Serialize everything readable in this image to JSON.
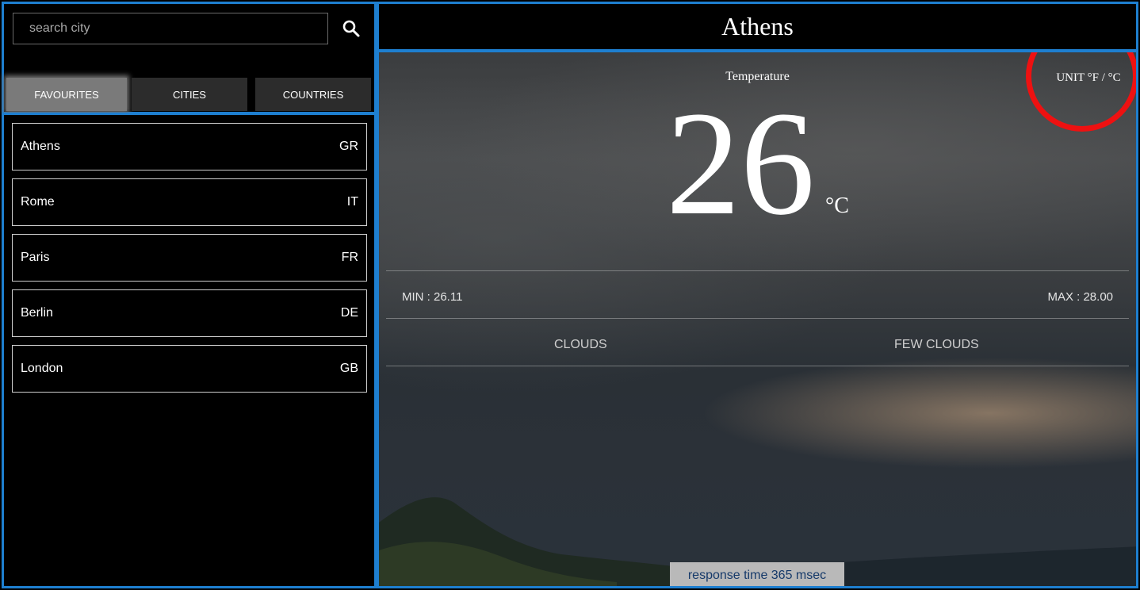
{
  "search": {
    "placeholder": "search city"
  },
  "tabs": [
    {
      "label": "FAVOURITES",
      "active": true
    },
    {
      "label": "CITIES",
      "active": false
    },
    {
      "label": "COUNTRIES",
      "active": false
    }
  ],
  "favourites": [
    {
      "city": "Athens",
      "country": "GR"
    },
    {
      "city": "Rome",
      "country": "IT"
    },
    {
      "city": "Paris",
      "country": "FR"
    },
    {
      "city": "Berlin",
      "country": "DE"
    },
    {
      "city": "London",
      "country": "GB"
    }
  ],
  "weather": {
    "city": "Athens",
    "temperature_label": "Temperature",
    "unit_toggle": "UNIT °F / °C",
    "temperature": "26",
    "unit": "°C",
    "min": "MIN : 26.11",
    "max": "MAX : 28.00",
    "main": "CLOUDS",
    "description": "FEW CLOUDS",
    "response_time": "response time 365 msec"
  },
  "colors": {
    "panel_border": "#1e7fd0",
    "highlight_circle": "#ee1111",
    "active_tab": "#7a7a7a",
    "inactive_tab": "#2c2c2c"
  },
  "icons": {
    "search": "search-icon"
  }
}
